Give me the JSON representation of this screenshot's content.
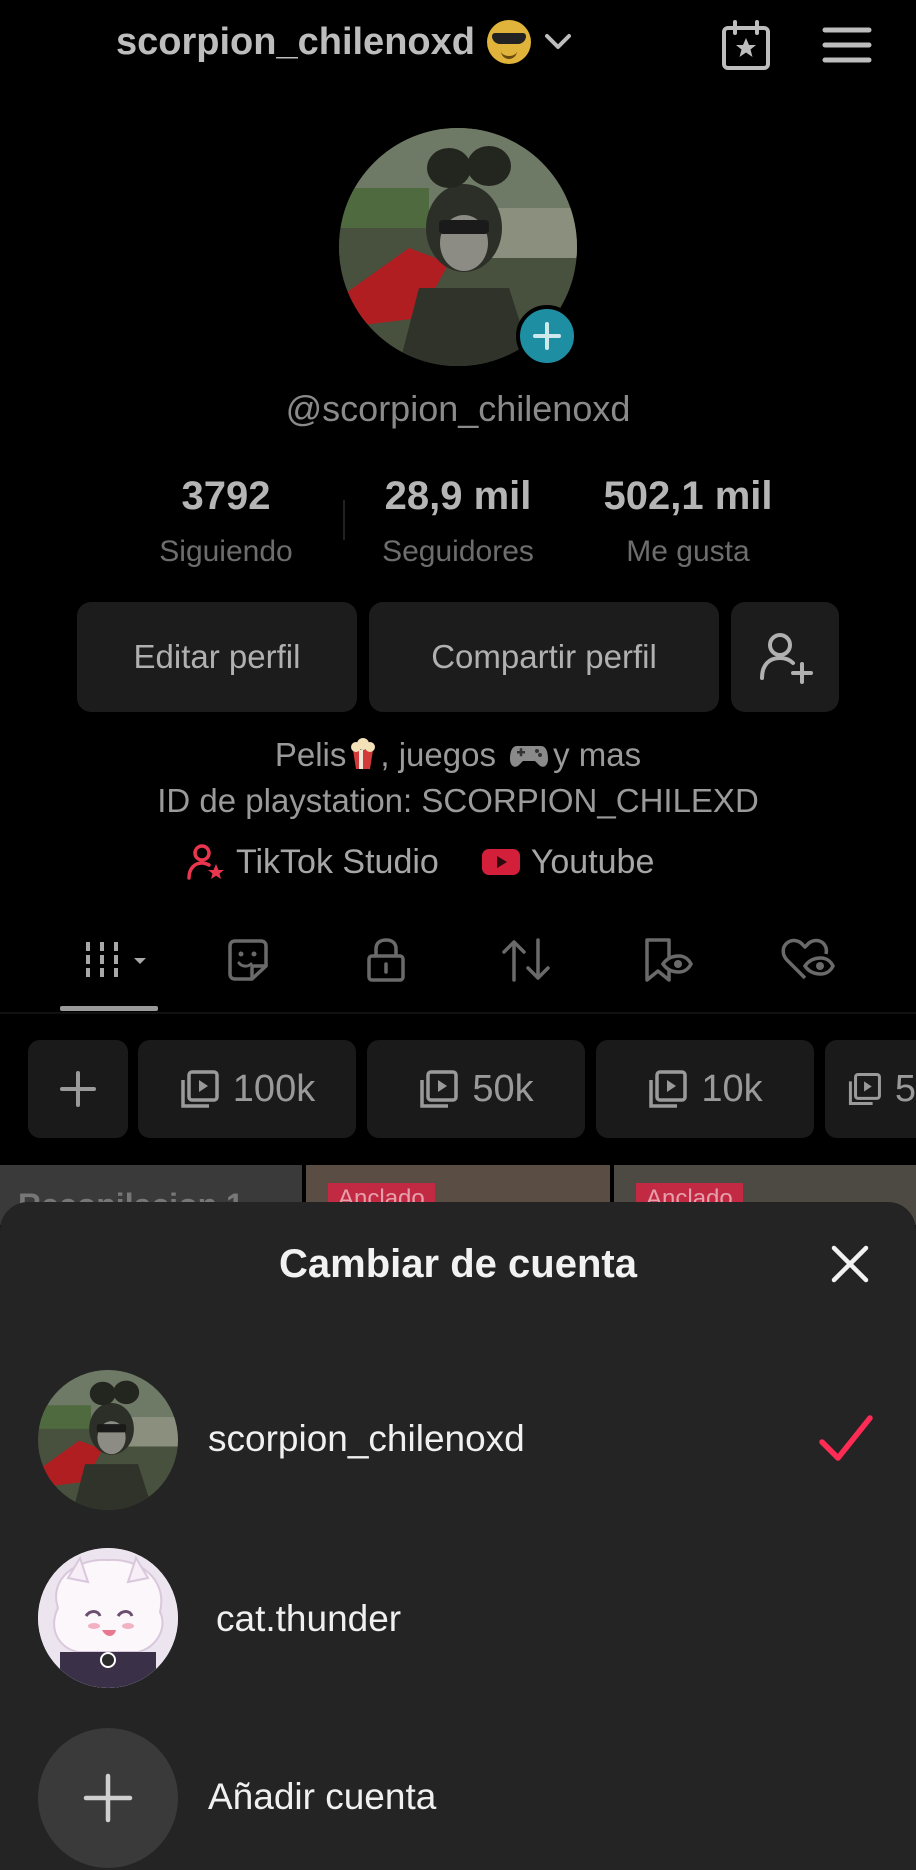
{
  "header": {
    "username": "scorpion_chilenoxd",
    "emoji": "sunglasses-face",
    "icons": [
      "chevron-down-icon",
      "calendar-star-icon",
      "menu-icon"
    ]
  },
  "profile": {
    "handle": "@scorpion_chilenoxd",
    "stats": [
      {
        "value": "3792",
        "label": "Siguiendo"
      },
      {
        "value": "28,9 mil",
        "label": "Seguidores"
      },
      {
        "value": "502,1 mil",
        "label": "Me gusta"
      }
    ],
    "buttons": {
      "edit": "Editar perfil",
      "share": "Compartir perfil"
    },
    "bio_line1_a": "Pelis",
    "bio_line1_b": ", juegos",
    "bio_line1_c": "y mas",
    "bio_line2": "ID de playstation: SCORPION_CHILEXD",
    "links": {
      "studio": "TikTok Studio",
      "youtube": "Youtube"
    }
  },
  "tabs": [
    "videos-grid-icon",
    "stickers-icon",
    "private-lock-icon",
    "repost-icon",
    "saved-icon",
    "liked-icon"
  ],
  "chips": [
    {
      "label": "100k"
    },
    {
      "label": "50k"
    },
    {
      "label": "10k"
    },
    {
      "label": "5"
    }
  ],
  "thumbnails": {
    "first": "Recopilacion 1",
    "badge": "Anclado"
  },
  "sheet": {
    "title": "Cambiar de cuenta",
    "accounts": [
      {
        "name": "scorpion_chilenoxd",
        "selected": true
      },
      {
        "name": "cat.thunder",
        "selected": false
      }
    ],
    "add_label": "Añadir cuenta"
  },
  "colors": {
    "accent": "#fe2c55",
    "avatar_plus": "#1e8fa2",
    "sheet_bg": "#242424"
  }
}
